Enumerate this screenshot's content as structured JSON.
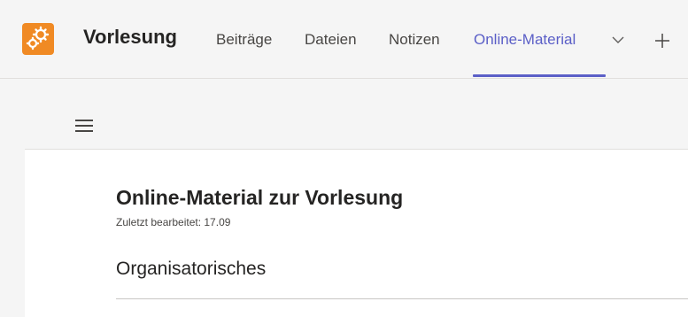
{
  "header": {
    "team_name": "Vorlesung",
    "app_icon": "gears-icon",
    "tabs": [
      {
        "label": "Beiträge",
        "active": false
      },
      {
        "label": "Dateien",
        "active": false
      },
      {
        "label": "Notizen",
        "active": false
      },
      {
        "label": "Online-Material",
        "active": true
      }
    ],
    "accent_color": "#5b5fc7",
    "icon_color": "#f08a24"
  },
  "toolbar": {
    "menu_icon": "hamburger-menu-icon"
  },
  "document": {
    "title": "Online-Material zur Vorlesung",
    "last_edited": "Zuletzt bearbeitet: 17.09",
    "sections": [
      {
        "heading": "Organisatorisches"
      }
    ]
  }
}
